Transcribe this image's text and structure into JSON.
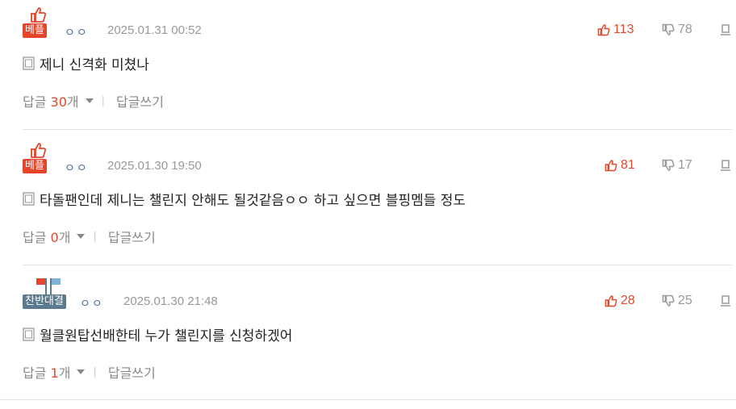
{
  "comments": [
    {
      "badge": "베플",
      "badge_type": "best",
      "nickname": "ㅇㅇ",
      "date": "2025.01.31 00:52",
      "up": "113",
      "down": "78",
      "text": "제니 신격화 미쳤나",
      "reply_label": "답글",
      "reply_count": "30",
      "reply_unit": "개",
      "write_reply": "답글쓰기"
    },
    {
      "badge": "베플",
      "badge_type": "best",
      "nickname": "ㅇㅇ",
      "date": "2025.01.30 19:50",
      "up": "81",
      "down": "17",
      "text": "타돌팬인데 제니는 챌린지 안해도 될것같음ㅇㅇ 하고 싶으면 블핑멤들 정도",
      "reply_label": "답글",
      "reply_count": "0",
      "reply_unit": "개",
      "write_reply": "답글쓰기"
    },
    {
      "badge": "찬반대결",
      "badge_type": "vs",
      "nickname": "ㅇㅇ",
      "date": "2025.01.30 21:48",
      "up": "28",
      "down": "25",
      "text": "월클원탑선배한테 누가 챌린지를 신청하겠어",
      "reply_label": "답글",
      "reply_count": "1",
      "reply_unit": "개",
      "write_reply": "답글쓰기"
    }
  ],
  "colors": {
    "accent_red": "#e04a2d",
    "badge_best": "#e8432b",
    "badge_vs": "#5a7a90",
    "meta_gray": "#999999"
  },
  "icons": [
    "thumbs-up-badge-icon",
    "flags-icon",
    "thumbs-up-icon",
    "thumbs-down-icon",
    "report-icon",
    "document-icon",
    "caret-down-icon"
  ]
}
